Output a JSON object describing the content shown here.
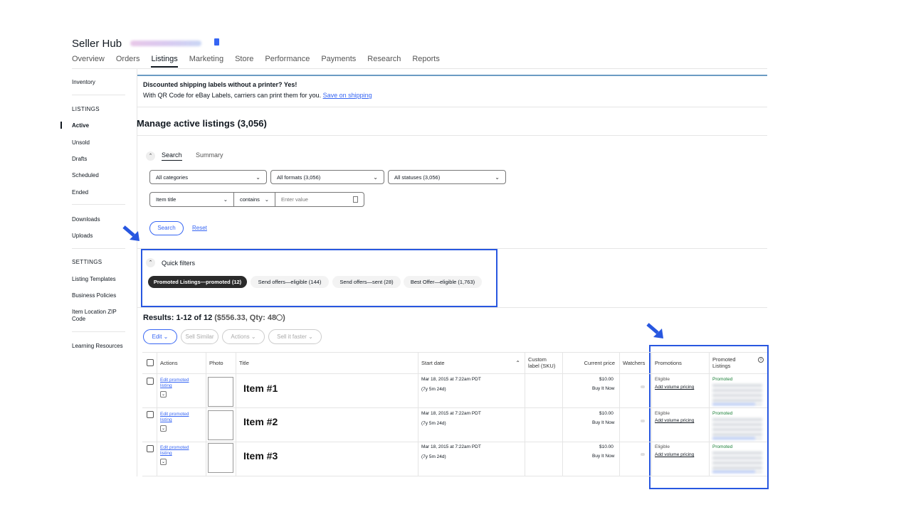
{
  "header": {
    "title": "Seller Hub",
    "nav": [
      "Overview",
      "Orders",
      "Listings",
      "Marketing",
      "Store",
      "Performance",
      "Payments",
      "Research",
      "Reports"
    ],
    "active_nav": "Listings"
  },
  "sidebar": {
    "inventory": "Inventory",
    "listings_heading": "LISTINGS",
    "listings": [
      "Active",
      "Unsold",
      "Drafts",
      "Scheduled",
      "Ended"
    ],
    "tools": [
      "Downloads",
      "Uploads"
    ],
    "settings_heading": "SETTINGS",
    "settings": [
      "Listing Templates",
      "Business Policies",
      "Item Location ZIP",
      "Code"
    ],
    "learning": "Learning Resources"
  },
  "banner": {
    "title": "Discounted shipping labels without a printer? Yes!",
    "text": "With QR Code for eBay Labels, carriers can print them for you.",
    "link": "Save on shipping"
  },
  "page_title": "Manage active listings (3,056)",
  "search": {
    "tab_search": "Search",
    "tab_summary": "Summary",
    "categories": "All categories",
    "formats": "All formats (3,056)",
    "statuses": "All statuses (3,056)",
    "field": "Item title",
    "operator": "contains",
    "placeholder": "Enter value",
    "search_button": "Search",
    "reset": "Reset"
  },
  "quick_filters": {
    "title": "Quick filters",
    "chips": [
      "Promoted Listings—promoted (12)",
      "Send offers—eligible (144)",
      "Send offers—sent (28)",
      "Best Offer—eligible (1,763)"
    ]
  },
  "results": {
    "count": "Results: 1-12 of 12",
    "total": "($556.33, Qty: 48",
    "total_end": ")",
    "buttons": [
      "Edit",
      "Sell Similar",
      "Actions",
      "Sell it faster"
    ]
  },
  "table": {
    "headers": {
      "actions": "Actions",
      "photo": "Photo",
      "title": "Title",
      "start_date": "Start date",
      "custom_label_1": "Custom",
      "custom_label_2": "label (SKU)",
      "price": "Current price",
      "watchers": "Watchers",
      "promotions": "Promotions",
      "promoted_1": "Promoted",
      "promoted_2": "Listings"
    },
    "rows": [
      {
        "action_1": "Edit promoted",
        "action_2": "listing",
        "title": "Item #1",
        "date": "Mar 18, 2015 at 7:22am PDT",
        "age": "(7y 5m 24d)",
        "price": "$10.00",
        "format": "Buy It Now",
        "promo": "Eligible",
        "promo_link": "Add volume pricing",
        "status": "Promoted"
      },
      {
        "action_1": "Edit promoted",
        "action_2": "listing",
        "title": "Item #2",
        "date": "Mar 18, 2015 at 7:22am PDT",
        "age": "(7y 5m 24d)",
        "price": "$10.00",
        "format": "Buy It Now",
        "promo": "Eligible",
        "promo_link": "Add volume pricing",
        "status": "Promoted"
      },
      {
        "action_1": "Edit promoted",
        "action_2": "listing",
        "title": "Item #3",
        "date": "Mar 18, 2015 at 7:22am PDT",
        "age": "(7y 5m 24d)",
        "price": "$10.00",
        "format": "Buy It Now",
        "promo": "Eligible",
        "promo_link": "Add volume pricing",
        "status": "Promoted"
      }
    ]
  },
  "colors": {
    "highlight": "#2857e0",
    "link": "#3665f3",
    "promoted": "#1a7f37"
  },
  "icons": {
    "arrow": "arrow-down-right-icon",
    "info": "info-icon",
    "caret": "chevron-down-icon"
  }
}
